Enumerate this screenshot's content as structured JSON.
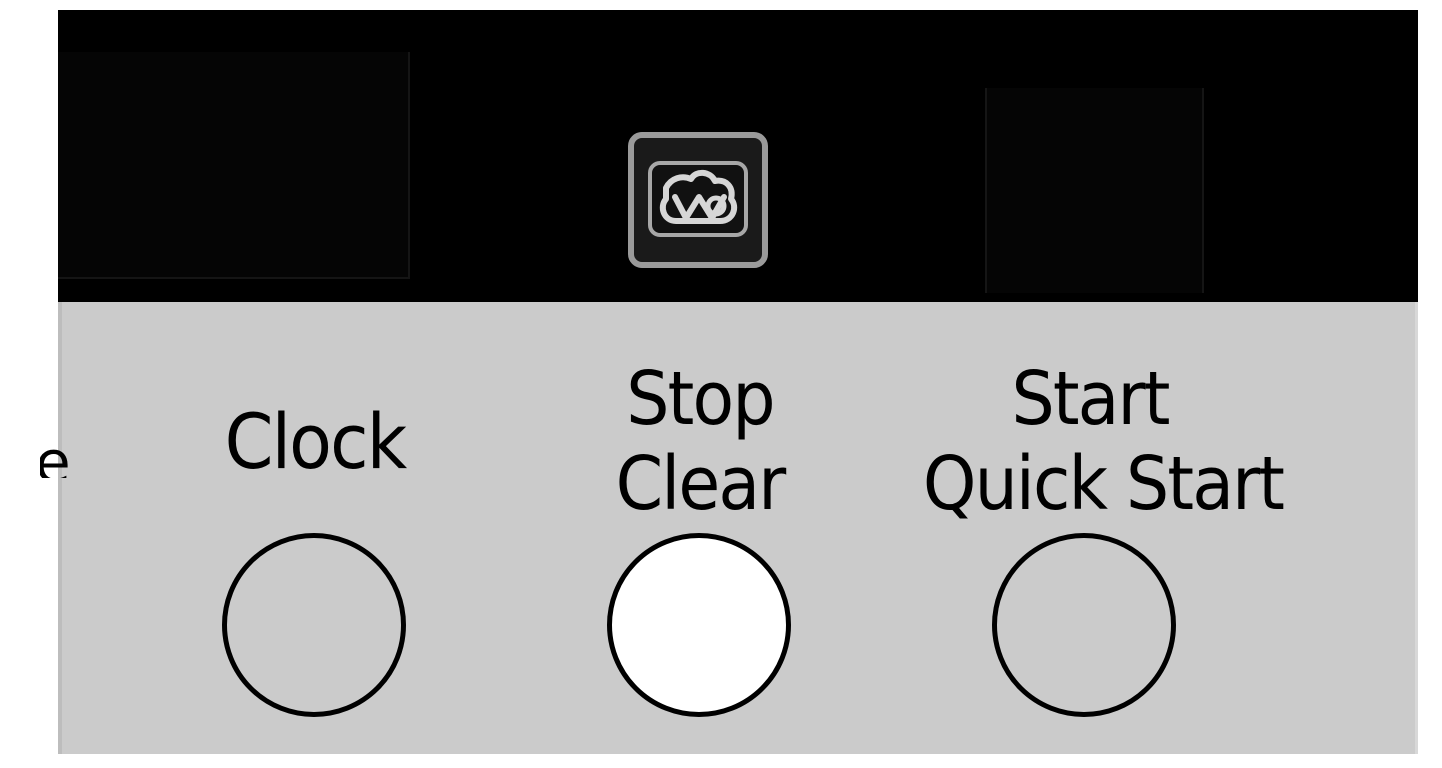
{
  "display": {
    "sensor_icon": "steam-sensor-icon"
  },
  "controls": {
    "clipped_label": "e",
    "clock_label": "Clock",
    "stop_label": "Stop",
    "clear_label": "Clear",
    "start_label": "Start",
    "quick_start_label": "Quick Start"
  },
  "colors": {
    "display": "#000000",
    "panel": "#cbcbcb",
    "text": "#000000",
    "button_outline": "#000000",
    "active_button": "#ffffff"
  }
}
